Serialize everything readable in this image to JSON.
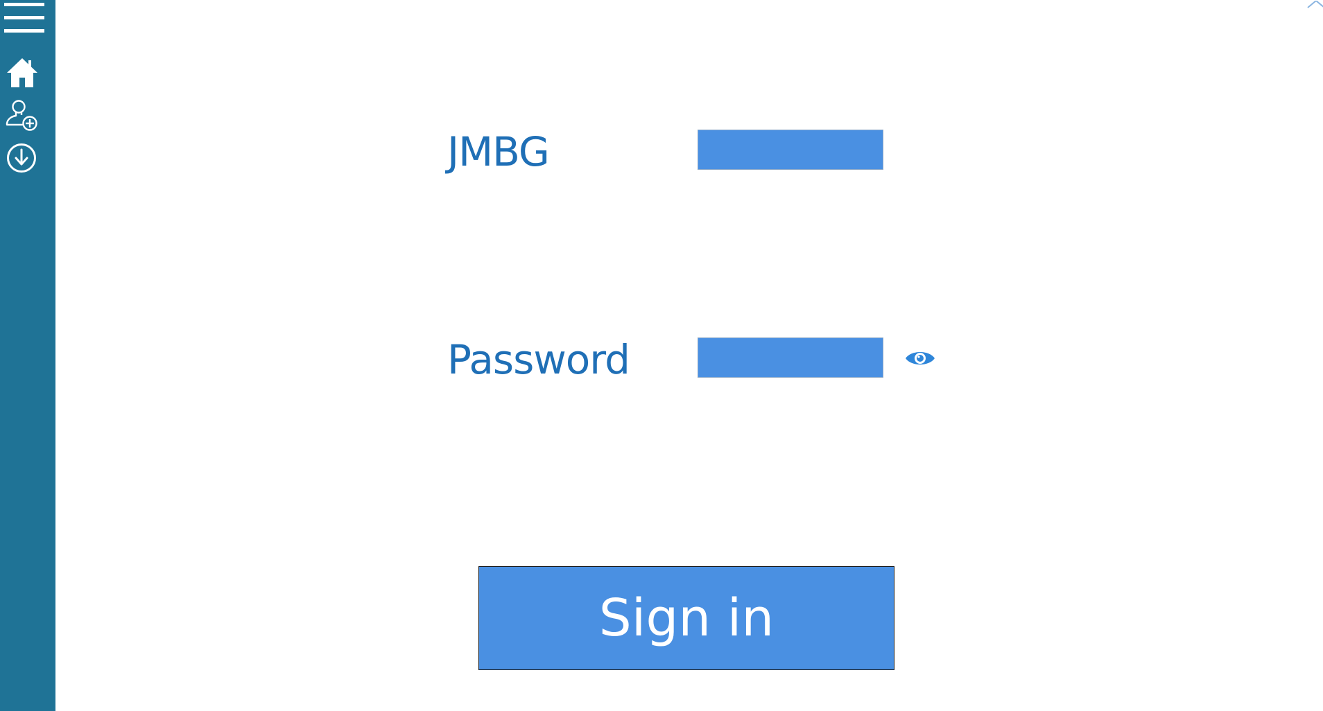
{
  "form": {
    "jmbg_label": "JMBG",
    "jmbg_value": "",
    "password_label": "Password",
    "password_value": "",
    "sign_in_label": "Sign in"
  },
  "sidebar": {
    "items": [
      {
        "icon": "hamburger-menu-icon"
      },
      {
        "icon": "home-icon"
      },
      {
        "icon": "add-user-icon"
      },
      {
        "icon": "download-icon"
      }
    ]
  },
  "colors": {
    "sidebar_bg": "#1f7396",
    "accent": "#4a90e2",
    "label_text": "#1f6fb6",
    "button_text": "#ffffff"
  }
}
